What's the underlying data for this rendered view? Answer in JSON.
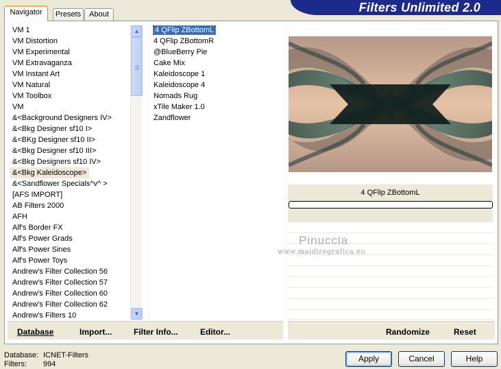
{
  "app_title": "Filters Unlimited 2.0",
  "tabs": [
    {
      "label": "Navigator",
      "active": true
    },
    {
      "label": "Presets",
      "active": false
    },
    {
      "label": "About",
      "active": false
    }
  ],
  "categories": [
    "VM 1",
    "VM Distortion",
    "VM Experimental",
    "VM Extravaganza",
    "VM Instant Art",
    "VM Natural",
    "VM Toolbox",
    "VM",
    "&<Background Designers IV>",
    "&<Bkg Designer sf10 I>",
    "&<BKg Designer sf10 II>",
    "&<Bkg Designer sf10 III>",
    "&<Bkg Designers sf10 IV>",
    "&<Bkg Kaleidoscope>",
    "&<Sandflower Specials^v^ >",
    "[AFS IMPORT]",
    "AB Filters 2000",
    "AFH",
    "Alf's Border FX",
    "Alf's Power Grads",
    "Alf's Power Sines",
    "Alf's Power Toys",
    "Andrew's Filter Collection 56",
    "Andrew's Filter Collection 57",
    "Andrew's Filter Collection 60",
    "Andrew's Filter Collection 62",
    "Andrew's Filters 10"
  ],
  "selected_category_index": 13,
  "filters": [
    "4 QFlip ZBottomL",
    "4 QFlip ZBottomR",
    "@BlueBerry Pie",
    "Cake Mix",
    "Kaleidoscope 1",
    "Kaleidoscope 4",
    "Nomads Rug",
    "xTile Maker 1.0",
    "Zandflower"
  ],
  "selected_filter_index": 0,
  "selected_filter_name": "4 QFlip ZBottomL",
  "progress": 0,
  "watermark": {
    "name": "Pinuccia",
    "url": "www.maidiregrafica.eu"
  },
  "toolbar": {
    "database": "Database",
    "import": "Import...",
    "filter_info": "Filter Info...",
    "editor": "Editor...",
    "randomize": "Randomize",
    "reset": "Reset"
  },
  "status": {
    "database_label": "Database:",
    "database_value": "ICNET-Filters",
    "filters_label": "Filters:",
    "filters_value": "994"
  },
  "buttons": {
    "apply": "Apply",
    "cancel": "Cancel",
    "help": "Help"
  },
  "colors": {
    "banner": "#1c2a8c",
    "selection": "#316ac5",
    "dialog_bg": "#ece9d8"
  }
}
